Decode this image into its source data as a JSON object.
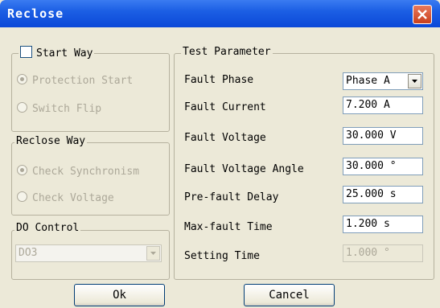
{
  "window": {
    "title": "Reclose"
  },
  "start_way": {
    "checkbox_label": "Start Way",
    "options": [
      "Protection Start",
      "Switch Flip"
    ]
  },
  "reclose_way": {
    "label": "Reclose Way",
    "options": [
      "Check Synchronism",
      "Check Voltage"
    ]
  },
  "do_control": {
    "label": "DO Control",
    "selected": "DO3"
  },
  "test_parameter": {
    "label": "Test Parameter",
    "fault_phase": {
      "label": "Fault Phase",
      "value": "Phase A"
    },
    "fault_current": {
      "label": "Fault Current",
      "value": "7.200 A"
    },
    "fault_voltage": {
      "label": "Fault Voltage",
      "value": "30.000 V"
    },
    "fault_voltage_angle": {
      "label": "Fault Voltage Angle",
      "value": "30.000 °"
    },
    "pre_fault_delay": {
      "label": "Pre-fault Delay",
      "value": "25.000 s"
    },
    "max_fault_time": {
      "label": "Max-fault Time",
      "value": "1.200 s"
    },
    "setting_time": {
      "label": "Setting Time",
      "value": "1.000 °"
    }
  },
  "buttons": {
    "ok": "Ok",
    "cancel": "Cancel"
  },
  "colors": {
    "titlebar": "#0b48d8",
    "close": "#c9401d",
    "face": "#ece9d8"
  }
}
